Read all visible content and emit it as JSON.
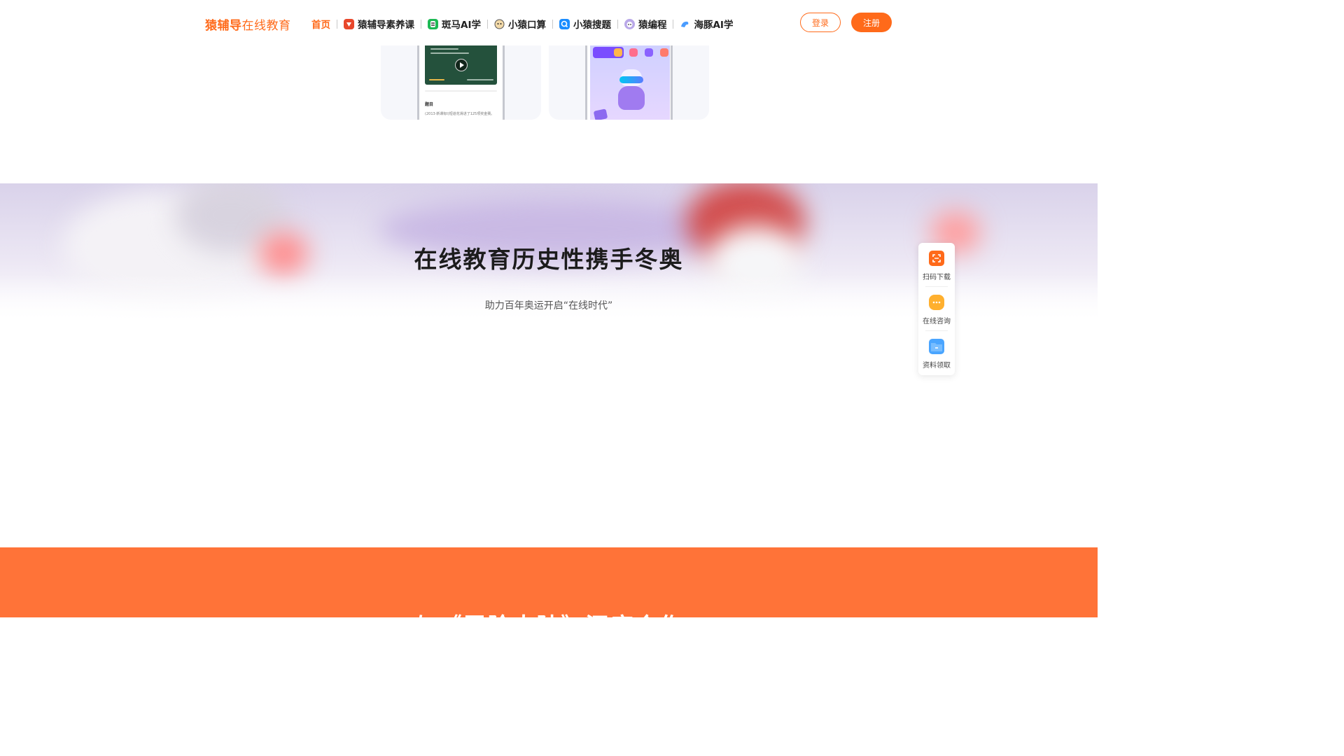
{
  "header": {
    "logo_brand": "猿辅导",
    "logo_sub": "在线教育",
    "nav": [
      {
        "label": "首页",
        "icon": "home",
        "active": true
      },
      {
        "label": "猿辅导素养课",
        "icon": "yuanfudao-suyang-icon"
      },
      {
        "label": "斑马AI学",
        "icon": "zebra-icon"
      },
      {
        "label": "小猿口算",
        "icon": "xiaoyuan-kousuan-icon"
      },
      {
        "label": "小猿搜题",
        "icon": "xiaoyuan-soti-icon"
      },
      {
        "label": "猿编程",
        "icon": "yuanbiancheng-icon"
      },
      {
        "label": "海豚AI学",
        "icon": "dolphin-icon"
      }
    ],
    "login_label": "登录",
    "register_label": "注册"
  },
  "cards": {
    "q_title": "题目",
    "q_text": "(2013·新课标Ⅰ)短道花滑进了125项奖金赛。"
  },
  "banner": {
    "title": "在线教育历史性携手冬奥",
    "subtitle": "助力百年奥运开启“在线时代”"
  },
  "sidebar": {
    "items": [
      {
        "label": "扫码下载",
        "icon": "scan-icon"
      },
      {
        "label": "在线咨询",
        "icon": "chat-icon"
      },
      {
        "label": "资料领取",
        "icon": "folder-icon"
      }
    ]
  },
  "next_section": {
    "title": "与《冒险大陆》深度合作"
  },
  "colors": {
    "accent": "#ff6a1a",
    "orange_band": "#ff7338"
  }
}
